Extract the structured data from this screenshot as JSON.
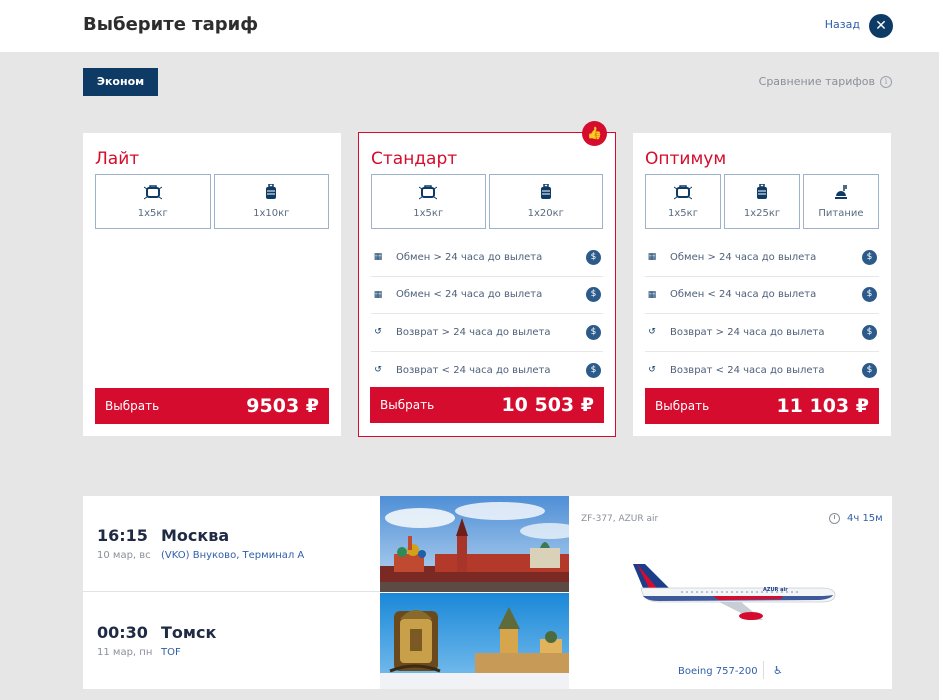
{
  "header": {
    "title": "Выберите тариф",
    "back_label": "Назад",
    "close_icon": "close-icon"
  },
  "class_tab": "Эконом",
  "compare_label": "Сравнение тарифов",
  "colors": {
    "brand_red": "#d50c2d",
    "navy": "#0e3b66",
    "background": "#e6e6e6"
  },
  "tariffs": [
    {
      "name": "Лайт",
      "features": [
        {
          "icon": "carry-on-bag-icon",
          "label": "1x5кг"
        },
        {
          "icon": "suitcase-icon",
          "label": "1x10кг"
        }
      ],
      "conditions": [],
      "select_label": "Выбрать",
      "price": "9503 ₽"
    },
    {
      "name": "Стандарт",
      "recommended": true,
      "features": [
        {
          "icon": "carry-on-bag-icon",
          "label": "1x5кг"
        },
        {
          "icon": "suitcase-icon",
          "label": "1x20кг"
        }
      ],
      "conditions": [
        {
          "icon": "calendar-icon",
          "text": "Обмен > 24 часа до вылета"
        },
        {
          "icon": "calendar-icon",
          "text": "Обмен < 24 часа до вылета"
        },
        {
          "icon": "return-arrow-icon",
          "text": "Возврат > 24 часа до вылета"
        },
        {
          "icon": "return-arrow-icon",
          "text": "Возврат < 24 часа до вылета"
        }
      ],
      "select_label": "Выбрать",
      "price": "10 503 ₽"
    },
    {
      "name": "Оптимум",
      "features": [
        {
          "icon": "carry-on-bag-icon",
          "label": "1x5кг"
        },
        {
          "icon": "suitcase-icon",
          "label": "1x25кг"
        },
        {
          "icon": "meal-icon",
          "label": "Питание"
        }
      ],
      "conditions": [
        {
          "icon": "calendar-icon",
          "text": "Обмен > 24 часа до вылета"
        },
        {
          "icon": "calendar-icon",
          "text": "Обмен < 24 часа до вылета"
        },
        {
          "icon": "return-arrow-icon",
          "text": "Возврат > 24 часа до вылета"
        },
        {
          "icon": "return-arrow-icon",
          "text": "Возврат < 24 часа до вылета"
        }
      ],
      "select_label": "Выбрать",
      "price": "11 103 ₽"
    }
  ],
  "flight": {
    "departure": {
      "time": "16:15",
      "city": "Москва",
      "date": "10 мар, вс",
      "airport": "(VKO) Внуково, Терминал A"
    },
    "arrival": {
      "time": "00:30",
      "city": "Томск",
      "date": "11 мар, пн",
      "airport": "TOF"
    },
    "flight_number": "ZF-377, AZUR air",
    "duration": "4ч 15м",
    "aircraft": "Boeing 757-200",
    "airline_logo_text": "AZUR air"
  }
}
